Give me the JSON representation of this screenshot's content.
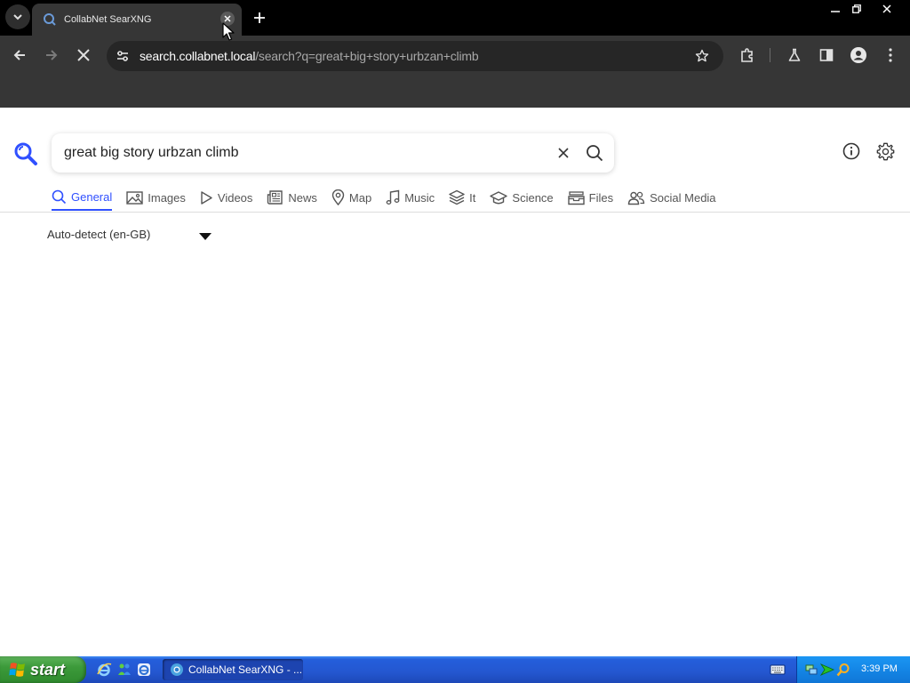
{
  "browser": {
    "tab_title": "CollabNet SearXNG",
    "url_host": "search.collabnet.local",
    "url_path": "/search?q=great+big+story+urbzan+climb"
  },
  "search": {
    "query": "great big story urbzan climb"
  },
  "categories": [
    {
      "label": "General",
      "icon": "search-icon",
      "active": true
    },
    {
      "label": "Images",
      "icon": "image-icon",
      "active": false
    },
    {
      "label": "Videos",
      "icon": "play-icon",
      "active": false
    },
    {
      "label": "News",
      "icon": "newspaper-icon",
      "active": false
    },
    {
      "label": "Map",
      "icon": "map-pin-icon",
      "active": false
    },
    {
      "label": "Music",
      "icon": "music-note-icon",
      "active": false
    },
    {
      "label": "It",
      "icon": "layers-icon",
      "active": false
    },
    {
      "label": "Science",
      "icon": "graduation-cap-icon",
      "active": false
    },
    {
      "label": "Files",
      "icon": "archive-icon",
      "active": false
    },
    {
      "label": "Social Media",
      "icon": "people-icon",
      "active": false
    }
  ],
  "language_select": {
    "value": "Auto-detect (en-GB)"
  },
  "taskbar": {
    "start_label": "start",
    "task_label": "CollabNet SearXNG - ...",
    "clock": "3:39 PM"
  },
  "colors": {
    "accent": "#3050ff",
    "browser_frame": "#363636",
    "taskbar_blue": "#245edb",
    "start_green": "#3c9a3a"
  }
}
